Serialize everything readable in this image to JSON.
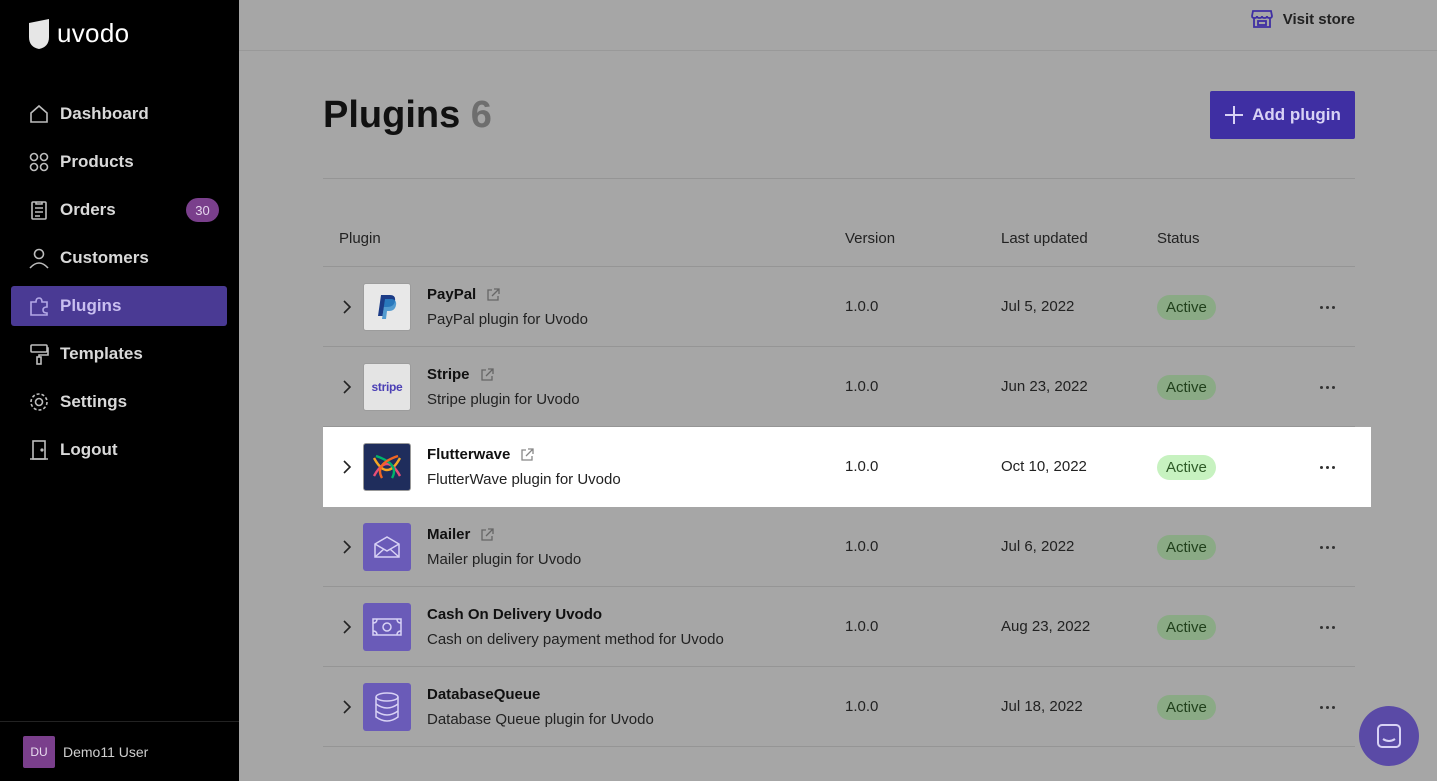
{
  "brand": {
    "name": "uvodo"
  },
  "sidebar": {
    "items": [
      {
        "label": "Dashboard",
        "icon": "home-icon"
      },
      {
        "label": "Products",
        "icon": "grid-icon"
      },
      {
        "label": "Orders",
        "icon": "clipboard-icon",
        "badge": "30"
      },
      {
        "label": "Customers",
        "icon": "user-icon"
      },
      {
        "label": "Plugins",
        "icon": "puzzle-icon",
        "active": true
      },
      {
        "label": "Templates",
        "icon": "paint-roller-icon"
      },
      {
        "label": "Settings",
        "icon": "gear-icon"
      },
      {
        "label": "Logout",
        "icon": "door-icon"
      }
    ],
    "user": {
      "initials": "DU",
      "name": "Demo11 User"
    }
  },
  "topbar": {
    "visit_store": "Visit store"
  },
  "header": {
    "title": "Plugins",
    "count": "6",
    "add_label": "Add plugin"
  },
  "table": {
    "columns": {
      "plugin": "Plugin",
      "version": "Version",
      "updated": "Last updated",
      "status": "Status"
    },
    "rows": [
      {
        "name": "PayPal",
        "desc": "PayPal plugin for Uvodo",
        "version": "1.0.0",
        "updated": "Jul 5, 2022",
        "status": "Active",
        "icon": "paypal-icon",
        "link": true
      },
      {
        "name": "Stripe",
        "desc": "Stripe plugin for Uvodo",
        "version": "1.0.0",
        "updated": "Jun 23, 2022",
        "status": "Active",
        "icon": "stripe-icon",
        "icon_text": "stripe",
        "link": true
      },
      {
        "name": "Flutterwave",
        "desc": "FlutterWave plugin for Uvodo",
        "version": "1.0.0",
        "updated": "Oct 10, 2022",
        "status": "Active",
        "icon": "flutterwave-icon",
        "link": true
      },
      {
        "name": "Mailer",
        "desc": "Mailer plugin for Uvodo",
        "version": "1.0.0",
        "updated": "Jul 6, 2022",
        "status": "Active",
        "icon": "envelope-icon",
        "link": true
      },
      {
        "name": "Cash On Delivery Uvodo",
        "desc": "Cash on delivery payment method for Uvodo",
        "version": "1.0.0",
        "updated": "Aug 23, 2022",
        "status": "Active",
        "icon": "cash-icon",
        "link": false
      },
      {
        "name": "DatabaseQueue",
        "desc": "Database Queue plugin for Uvodo",
        "version": "1.0.0",
        "updated": "Jul 18, 2022",
        "status": "Active",
        "icon": "database-icon",
        "link": false
      }
    ]
  },
  "colors": {
    "accent": "#3f2fa3",
    "active_nav": "#4a3a94",
    "badge": "#7a3f8c",
    "status_bg": "#c7f2c0"
  }
}
